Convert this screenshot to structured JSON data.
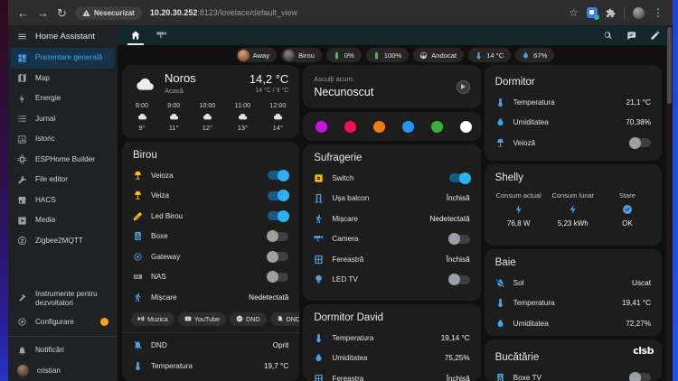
{
  "browser": {
    "security_label": "Nesecurizat",
    "url_host": "10.20.30.252",
    "url_path": ":8123/lovelace/default_view"
  },
  "sidebar": {
    "title": "Home Assistant",
    "items": [
      {
        "label": "Prezentare generală"
      },
      {
        "label": "Map"
      },
      {
        "label": "Energie"
      },
      {
        "label": "Jurnal"
      },
      {
        "label": "Istoric"
      },
      {
        "label": "ESPHome Builder"
      },
      {
        "label": "File editor"
      },
      {
        "label": "HACS"
      },
      {
        "label": "Media"
      },
      {
        "label": "Zigbee2MQTT"
      }
    ],
    "dev_tools": "Instrumente pentru dezvoltatori",
    "configure": "Configurare",
    "notifications": "Notificări",
    "user": "cristian"
  },
  "chips": [
    {
      "label": "Away"
    },
    {
      "label": "Birou"
    },
    {
      "label": "0%"
    },
    {
      "label": "100%"
    },
    {
      "label": "Andocat"
    },
    {
      "label": "14 °C"
    },
    {
      "label": "67%"
    }
  ],
  "weather": {
    "condition": "Noros",
    "location": "Acasă",
    "temperature": "14,2 °C",
    "high_low": "14 °C / 9 °C",
    "forecast": [
      {
        "time": "8:00",
        "temp": "9°"
      },
      {
        "time": "9:00",
        "temp": "11°"
      },
      {
        "time": "10:00",
        "temp": "12°"
      },
      {
        "time": "11:00",
        "temp": "13°"
      },
      {
        "time": "12:00",
        "temp": "14°"
      }
    ]
  },
  "media_player": {
    "prompt": "Asculți acum:",
    "track": "Necunoscut"
  },
  "palette": {
    "colors": [
      "#c513e0",
      "#f21050",
      "#f57a0e",
      "#1e96f5",
      "#36b336",
      "#ffffff",
      "#a8a8a8"
    ]
  },
  "cards": {
    "birou": {
      "title": "Birou",
      "rows": [
        {
          "name": "Veioza"
        },
        {
          "name": "Veiza"
        },
        {
          "name": "Led Birou"
        },
        {
          "name": "Boxe"
        },
        {
          "name": "Gateway"
        },
        {
          "name": "NAS"
        },
        {
          "name": "Mișcare",
          "value": "Nedetectată"
        },
        {
          "name": "DND",
          "value": "Oprit"
        },
        {
          "name": "Temperatura",
          "value": "19,7 °C"
        }
      ],
      "chips": [
        {
          "label": "Muzica"
        },
        {
          "label": "YouTube"
        },
        {
          "label": "DND"
        },
        {
          "label": "DND"
        }
      ]
    },
    "sufragerie": {
      "title": "Sufragerie",
      "rows": [
        {
          "name": "Switch"
        },
        {
          "name": "Ușa balcon",
          "value": "Închisă"
        },
        {
          "name": "Mișcare",
          "value": "Nedetectată"
        },
        {
          "name": "Camera"
        },
        {
          "name": "Fereastră",
          "value": "Închisă"
        },
        {
          "name": "LED TV"
        }
      ]
    },
    "dormitor_david": {
      "title": "Dormitor David",
      "rows": [
        {
          "name": "Temperatura",
          "value": "19,14 °C"
        },
        {
          "name": "Umiditatea",
          "value": "75,25%"
        },
        {
          "name": "Fereastra",
          "value": "Închisă"
        }
      ]
    },
    "dormitor": {
      "title": "Dormitor",
      "rows": [
        {
          "name": "Temperatura",
          "value": "21,1 °C"
        },
        {
          "name": "Umiditatea",
          "value": "70,38%"
        },
        {
          "name": "Veioză"
        }
      ]
    },
    "shelly": {
      "title": "Shelly",
      "columns": [
        {
          "label": "Consum actual",
          "value": "76,8 W"
        },
        {
          "label": "Consum lunar",
          "value": "5,23 kWh"
        },
        {
          "label": "Stare",
          "value": "OK"
        }
      ]
    },
    "baie": {
      "title": "Baie",
      "rows": [
        {
          "name": "Sol",
          "value": "Uscat"
        },
        {
          "name": "Temperatura",
          "value": "19,41 °C"
        },
        {
          "name": "Umiditatea",
          "value": "72,27%"
        }
      ]
    },
    "bucatarie": {
      "title": "Bucătărie",
      "watermark": "clsb",
      "rows": [
        {
          "name": "Boxe TV"
        }
      ]
    }
  }
}
